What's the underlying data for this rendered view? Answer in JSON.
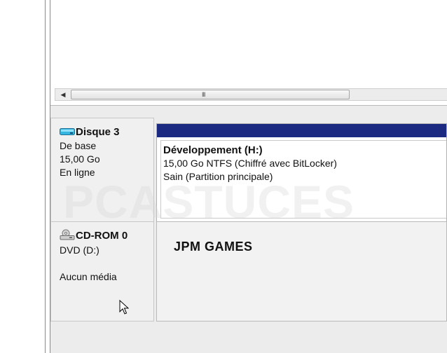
{
  "scrollbar": {
    "thumb_grip": "III"
  },
  "disk3": {
    "name": "Disque 3",
    "type": "De base",
    "size": "15,00 Go",
    "status": "En ligne",
    "icon": "disk-drive-icon"
  },
  "volume": {
    "name": "Développement  (H:)",
    "details": "15,00 Go NTFS (Chiffré avec BitLocker)",
    "health": "Sain (Partition principale)",
    "header_color": "#1b2a80"
  },
  "cdrom": {
    "name": "CD-ROM 0",
    "drive": "DVD (D:)",
    "media": "Aucun média",
    "icon": "cdrom-drive-icon"
  },
  "overlay": {
    "jpm": "JPM GAMES"
  },
  "watermark": "PCASTUCES"
}
